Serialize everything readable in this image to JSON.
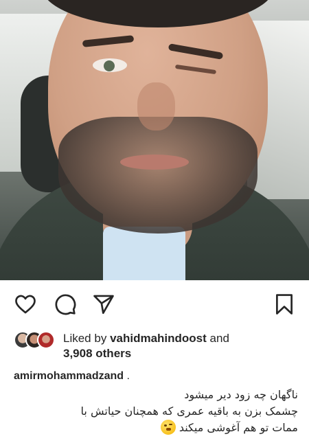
{
  "post": {
    "photo": {
      "alt_semantic": "post-photo"
    },
    "actions": {
      "like_icon": "heart-icon",
      "comment_icon": "speech-bubble-icon",
      "share_icon": "paper-plane-icon",
      "save_icon": "bookmark-icon"
    },
    "likes": {
      "prefix": "Liked by",
      "liker": "vahidmahindoost",
      "conjunction": "and",
      "others": "3,908 others"
    },
    "caption": {
      "username": "amirmohammadzand",
      "separator": ".",
      "line1": "ناگهان چه زود دیر میشود",
      "line2": "چشمک بزن به باقیه عمری که همچنان حیاتش با",
      "line3": "ممات تو هم آغوشی میکند"
    }
  },
  "colors": {
    "text": "#262626",
    "background": "#ffffff"
  }
}
